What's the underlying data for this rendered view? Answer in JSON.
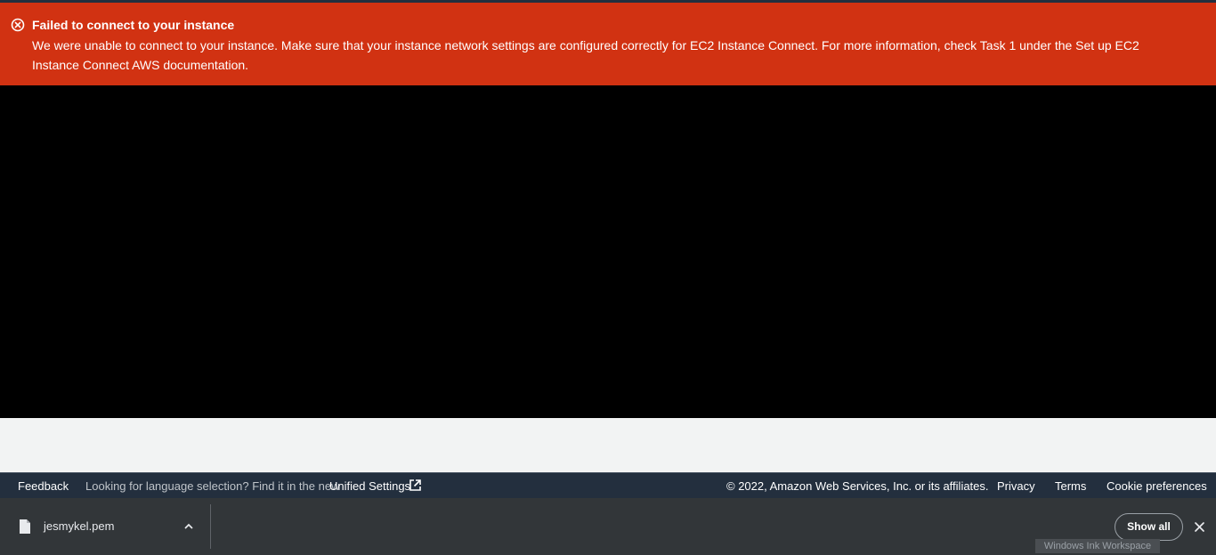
{
  "alert": {
    "icon": "error-circle-x-icon",
    "title": "Failed to connect to your instance",
    "message": "We were unable to connect to your instance. Make sure that your instance network settings are configured correctly for EC2 Instance Connect. For more information, check Task 1 under the Set up EC2 Instance Connect AWS documentation.",
    "color": "#d13212"
  },
  "terminal": {
    "background": "#000000"
  },
  "footer": {
    "feedback": "Feedback",
    "language_prompt": "Looking for language selection? Find it in the new",
    "unified_settings": "Unified Settings",
    "external_icon": "external-link-icon",
    "copyright": "© 2022, Amazon Web Services, Inc. or its affiliates.",
    "privacy": "Privacy",
    "terms": "Terms",
    "cookie_preferences": "Cookie preferences",
    "background": "#232f3e"
  },
  "downloads": {
    "items": [
      {
        "filename": "jesmykel.pem",
        "icon": "file-icon",
        "menu_icon": "chevron-up-icon"
      }
    ],
    "show_all": "Show all",
    "close_icon": "close-icon"
  },
  "tooltip": {
    "text": "Windows Ink Workspace"
  }
}
